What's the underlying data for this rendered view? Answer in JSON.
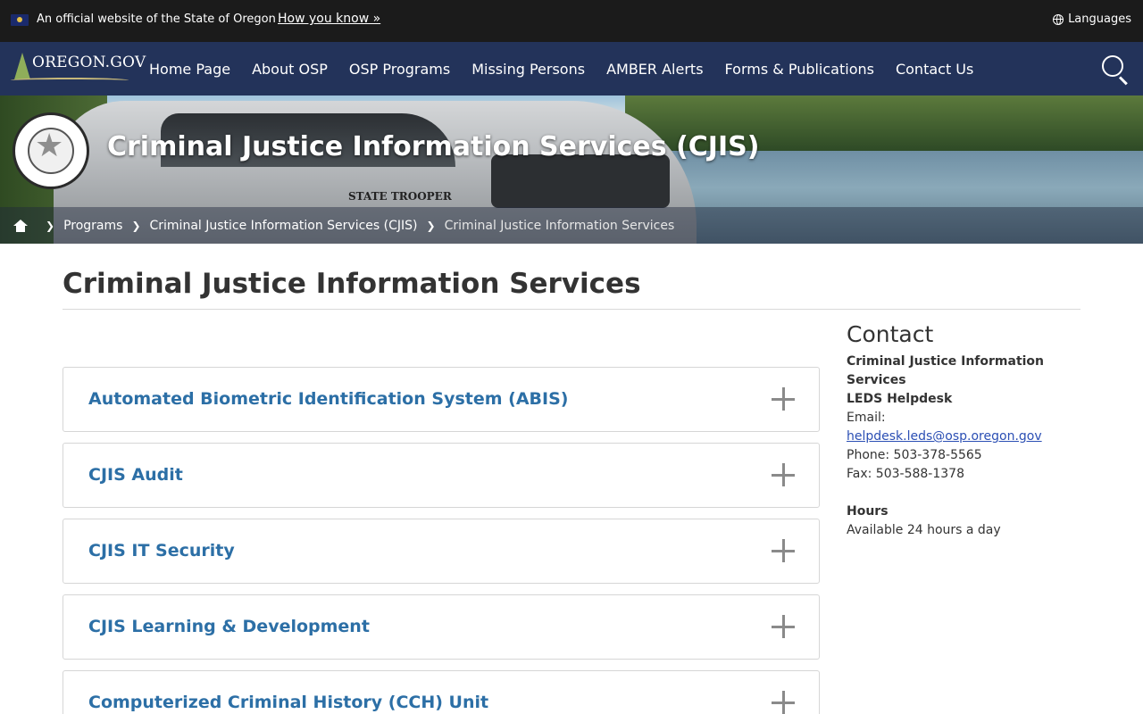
{
  "gov_bar": {
    "official_text": "An official website of the State of Oregon",
    "how_you_know": "How you know »",
    "languages": "Languages"
  },
  "logo": {
    "text": "OREGON.GOV"
  },
  "nav": {
    "items": [
      {
        "label": "Home Page"
      },
      {
        "label": "About OSP"
      },
      {
        "label": "OSP Programs"
      },
      {
        "label": "Missing Persons"
      },
      {
        "label": "AMBER Alerts"
      },
      {
        "label": "Forms & Publications"
      },
      {
        "label": "Contact Us"
      }
    ]
  },
  "hero": {
    "title": "Criminal Justice Information Services (CJIS)",
    "truck_text": "STATE TROOPER"
  },
  "breadcrumb": {
    "items": [
      {
        "label": "Programs"
      },
      {
        "label": "Criminal Justice Information Services (CJIS)"
      }
    ],
    "current": "Criminal Justice Information Services"
  },
  "page": {
    "title": "Criminal Justice Information Services"
  },
  "accordion": {
    "items": [
      {
        "label": "Automated Biometric Identification System (ABIS)"
      },
      {
        "label": "CJIS Audit"
      },
      {
        "label": "CJIS IT Security"
      },
      {
        "label": "CJIS Learning & Development"
      },
      {
        "label": "Computerized Criminal History (CCH) Unit"
      }
    ]
  },
  "contact": {
    "heading": "Contact",
    "org_line1": "Criminal Justice Information",
    "org_line2": "Services",
    "dept": "LEDS Helpdesk",
    "email_label": "Email:",
    "email": "helpdesk.leds@osp.oregon.gov",
    "phone": "Phone: 503-378-5565",
    "fax": "Fax: 503-588-1378",
    "hours_label": "Hours",
    "hours": "Available 24 hours a day"
  },
  "colors": {
    "gov_bar": "#1b1b1b",
    "nav": "#23335a",
    "accordion_link": "#2c6fa6",
    "contact_link": "#2b4fb4"
  }
}
